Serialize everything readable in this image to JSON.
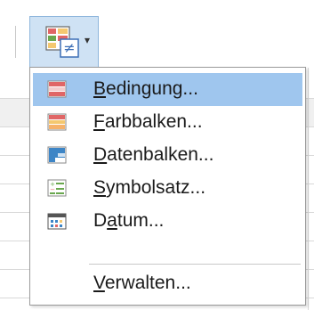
{
  "toolbar": {
    "button_icon": "conditional-format-icon",
    "caret": "▾"
  },
  "menu": {
    "items": [
      {
        "pre": "",
        "key": "B",
        "post": "edingung...",
        "icon": "conditional-condition-icon"
      },
      {
        "pre": "",
        "key": "F",
        "post": "arbbalken...",
        "icon": "color-scale-icon"
      },
      {
        "pre": "",
        "key": "D",
        "post": "atenbalken...",
        "icon": "data-bar-icon"
      },
      {
        "pre": "",
        "key": "S",
        "post": "ymbolsatz...",
        "icon": "icon-set-icon"
      },
      {
        "pre": "D",
        "key": "a",
        "post": "tum...",
        "icon": "date-icon"
      },
      {
        "pre": "",
        "key": "V",
        "post": "erwalten...",
        "icon": "manage-icon"
      }
    ],
    "highlight_color": "#9fc6ee"
  }
}
